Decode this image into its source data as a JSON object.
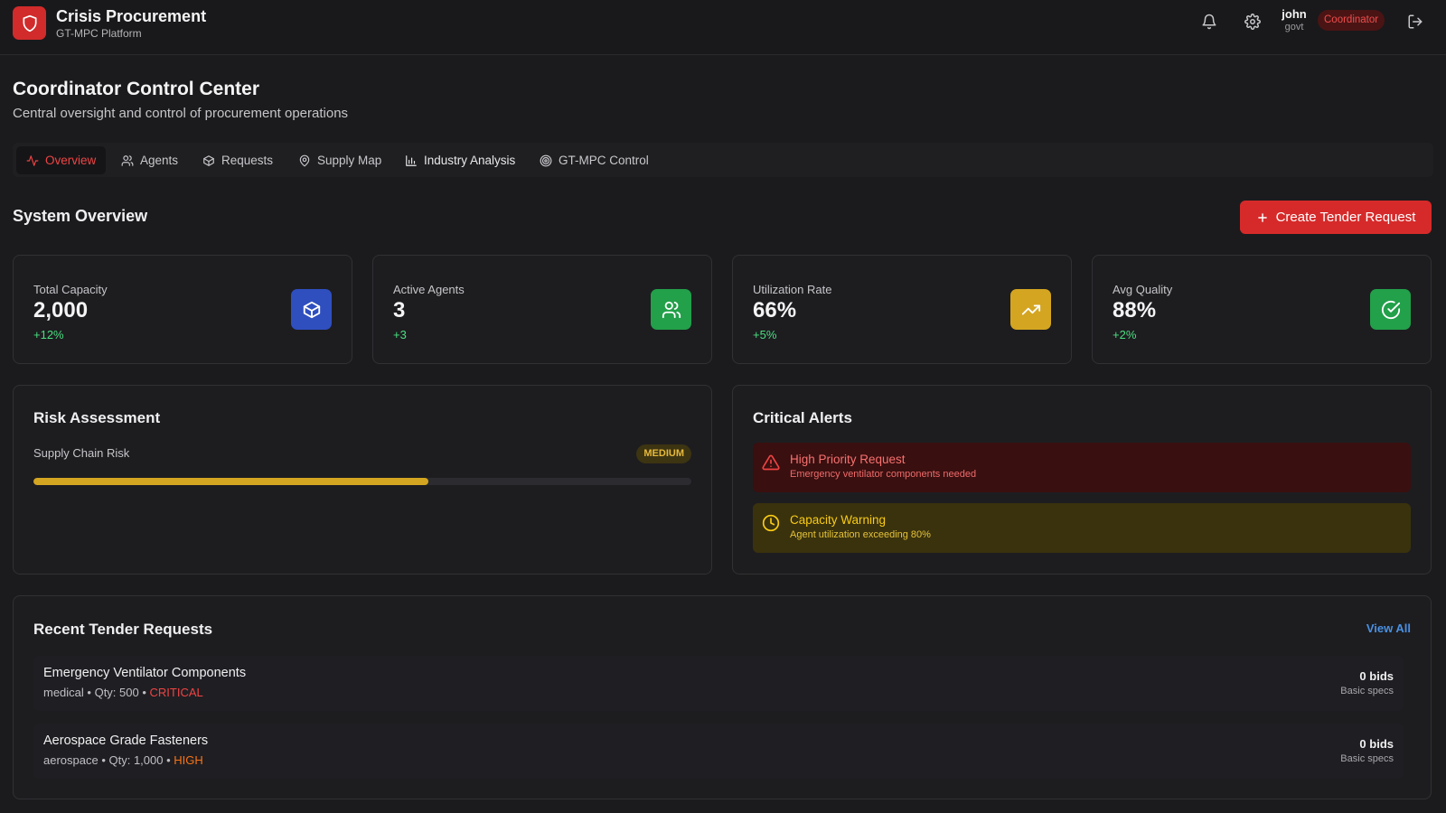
{
  "app": {
    "title": "Crisis Procurement",
    "subtitle": "GT-MPC Platform",
    "logo_icon": "shield-icon"
  },
  "header": {
    "icons": [
      "bell-icon",
      "gear-icon",
      "logout-icon"
    ],
    "user": {
      "name": "john",
      "org": "govt"
    },
    "role": "Coordinator"
  },
  "page": {
    "title": "Coordinator Control Center",
    "subtitle": "Central oversight and control of procurement operations"
  },
  "tabs": [
    {
      "label": "Overview",
      "icon": "activity-icon",
      "active": true
    },
    {
      "label": "Agents",
      "icon": "users-icon",
      "active": false
    },
    {
      "label": "Requests",
      "icon": "package-icon",
      "active": false
    },
    {
      "label": "Supply Map",
      "icon": "map-pin-icon",
      "active": false
    },
    {
      "label": "Industry Analysis",
      "icon": "bar-chart-icon",
      "active": false
    },
    {
      "label": "GT-MPC Control",
      "icon": "target-icon",
      "active": false
    }
  ],
  "overview": {
    "title": "System Overview",
    "create_button": "Create Tender Request"
  },
  "stats": [
    {
      "label": "Total Capacity",
      "value": "2,000",
      "delta": "+12%",
      "icon": "package-icon",
      "color": "#2f4fbf"
    },
    {
      "label": "Active Agents",
      "value": "3",
      "delta": "+3",
      "icon": "users-icon",
      "color": "#22a04a"
    },
    {
      "label": "Utilization Rate",
      "value": "66%",
      "delta": "+5%",
      "icon": "trending-up-icon",
      "color": "#d4a521"
    },
    {
      "label": "Avg Quality",
      "value": "88%",
      "delta": "+2%",
      "icon": "check-circle-icon",
      "color": "#22a04a"
    }
  ],
  "risk": {
    "title": "Risk Assessment",
    "label": "Supply Chain Risk",
    "level": "MEDIUM",
    "progress": 0.6
  },
  "alerts": {
    "title": "Critical Alerts",
    "items": [
      {
        "title": "High Priority Request",
        "description": "Emergency ventilator components needed",
        "icon": "alert-triangle-icon"
      },
      {
        "title": "Capacity Warning",
        "description": "Agent utilization exceeding 80%",
        "icon": "clock-icon"
      }
    ]
  },
  "recent": {
    "title": "Recent Tender Requests",
    "view_all": "View All",
    "items": [
      {
        "title": "Emergency Ventilator Components",
        "category": "medical",
        "qty": "Qty: 500",
        "severity": "CRITICAL",
        "bids": "0 bids",
        "specs": "Basic specs"
      },
      {
        "title": "Aerospace Grade Fasteners",
        "category": "aerospace",
        "qty": "Qty: 1,000",
        "severity": "HIGH",
        "bids": "0 bids",
        "specs": "Basic specs"
      }
    ]
  }
}
